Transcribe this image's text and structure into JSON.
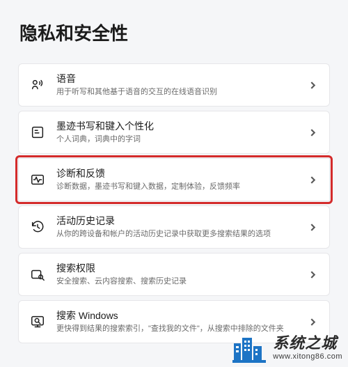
{
  "page_title": "隐私和安全性",
  "items": [
    {
      "icon": "voice-icon",
      "title": "语音",
      "subtitle": "用于听写和其他基于语音的交互的在线语音识别"
    },
    {
      "icon": "inking-icon",
      "title": "墨迹书写和键入个性化",
      "subtitle": "个人词典，词典中的字词"
    },
    {
      "icon": "diagnostics-icon",
      "title": "诊断和反馈",
      "subtitle": "诊断数据，墨迹书写和键入数据，定制体验，反馈频率",
      "highlight": true
    },
    {
      "icon": "history-icon",
      "title": "活动历史记录",
      "subtitle": "从你的跨设备和帐户的活动历史记录中获取更多搜索结果的选项"
    },
    {
      "icon": "search-permissions-icon",
      "title": "搜索权限",
      "subtitle": "安全搜索、云内容搜索、搜索历史记录"
    },
    {
      "icon": "search-windows-icon",
      "title": "搜索 Windows",
      "subtitle": "更快得到结果的搜索索引，\"查找我的文件\"，从搜索中排除的文件夹"
    }
  ],
  "watermark": {
    "title": "系统之城",
    "url": "www.xitong86.com"
  }
}
